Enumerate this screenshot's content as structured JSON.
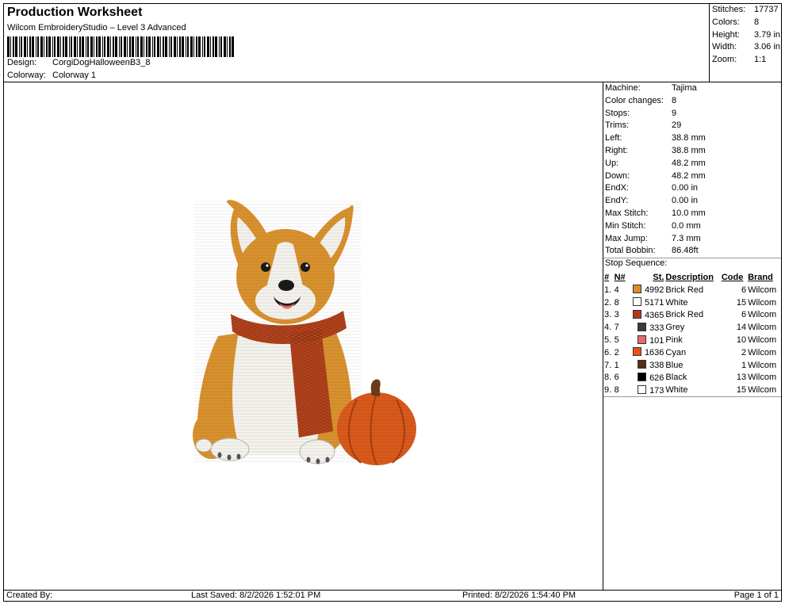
{
  "header": {
    "title": "Production Worksheet",
    "subtitle": "Wilcom EmbroideryStudio – Level 3 Advanced",
    "design_label": "Design:",
    "design_value": "CorgiDogHalloweenB3_8",
    "colorway_label": "Colorway:",
    "colorway_value": "Colorway 1"
  },
  "summary": [
    {
      "label": "Stitches:",
      "value": "17737"
    },
    {
      "label": "Colors:",
      "value": "8"
    },
    {
      "label": "Height:",
      "value": "3.79 in"
    },
    {
      "label": "Width:",
      "value": "3.06 in"
    },
    {
      "label": "Zoom:",
      "value": "1:1"
    }
  ],
  "machine_info": [
    {
      "label": "Machine:",
      "value": "Tajima"
    },
    {
      "label": "Color changes:",
      "value": "8"
    },
    {
      "label": "Stops:",
      "value": "9"
    },
    {
      "label": "Trims:",
      "value": "29"
    },
    {
      "label": "Left:",
      "value": "38.8 mm"
    },
    {
      "label": "Right:",
      "value": "38.8 mm"
    },
    {
      "label": "Up:",
      "value": "48.2 mm"
    },
    {
      "label": "Down:",
      "value": "48.2 mm"
    },
    {
      "label": "EndX:",
      "value": "0.00 in"
    },
    {
      "label": "EndY:",
      "value": "0.00 in"
    },
    {
      "label": "Max Stitch:",
      "value": "10.0 mm"
    },
    {
      "label": "Min Stitch:",
      "value": "0.0 mm"
    },
    {
      "label": "Max Jump:",
      "value": "7.3 mm"
    },
    {
      "label": "Total Bobbin:",
      "value": "86.48ft"
    }
  ],
  "stop_sequence": {
    "title": "Stop Sequence:",
    "headers": [
      "#",
      "N#",
      "St.",
      "Description",
      "Code",
      "Brand"
    ],
    "rows": [
      {
        "num": "1.",
        "n": "4",
        "color": "#e08a2a",
        "st": "4992",
        "desc": "Brick Red",
        "code": "6",
        "brand": "Wilcom"
      },
      {
        "num": "2.",
        "n": "8",
        "color": "#ffffff",
        "st": "5171",
        "desc": "White",
        "code": "15",
        "brand": "Wilcom"
      },
      {
        "num": "3.",
        "n": "3",
        "color": "#b23a1a",
        "st": "4365",
        "desc": "Brick Red",
        "code": "6",
        "brand": "Wilcom"
      },
      {
        "num": "4.",
        "n": "7",
        "color": "#3a3a3a",
        "st": "333",
        "desc": "Grey",
        "code": "14",
        "brand": "Wilcom"
      },
      {
        "num": "5.",
        "n": "5",
        "color": "#e86a6a",
        "st": "101",
        "desc": "Pink",
        "code": "10",
        "brand": "Wilcom"
      },
      {
        "num": "6.",
        "n": "2",
        "color": "#e8521a",
        "st": "1636",
        "desc": "Cyan",
        "code": "2",
        "brand": "Wilcom"
      },
      {
        "num": "7.",
        "n": "1",
        "color": "#5a2a1a",
        "st": "338",
        "desc": "Blue",
        "code": "1",
        "brand": "Wilcom"
      },
      {
        "num": "8.",
        "n": "6",
        "color": "#000000",
        "st": "626",
        "desc": "Black",
        "code": "13",
        "brand": "Wilcom"
      },
      {
        "num": "9.",
        "n": "8",
        "color": "#ffffff",
        "st": "173",
        "desc": "White",
        "code": "15",
        "brand": "Wilcom"
      }
    ]
  },
  "footer": {
    "created_by": "Created By:",
    "last_saved": "Last Saved: 8/2/2026 1:52:01 PM",
    "printed": "Printed: 8/2/2026 1:54:40 PM",
    "page": "Page 1 of 1"
  },
  "design_colors": {
    "fur_orange": "#d9912e",
    "fur_white": "#f4f2ec",
    "scarf": "#b4431c",
    "pumpkin": "#d85a1c",
    "stem": "#6a3a1a"
  }
}
